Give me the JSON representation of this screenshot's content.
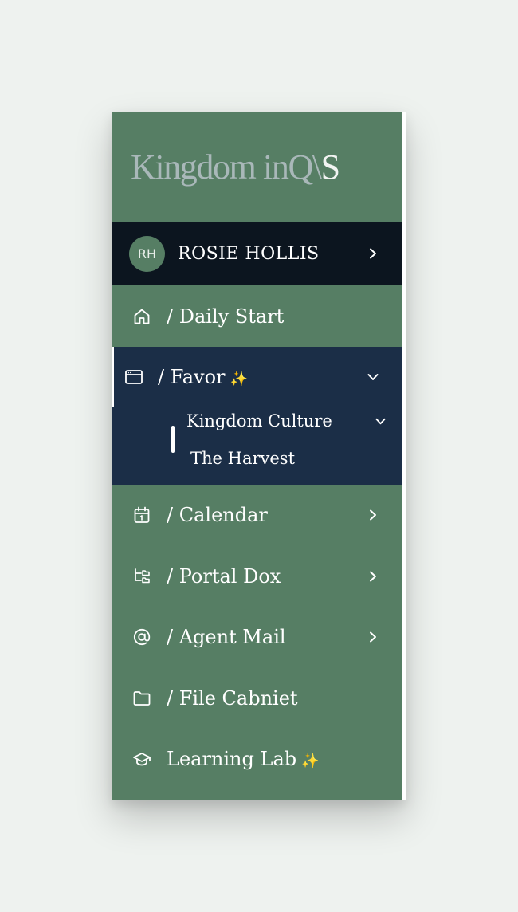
{
  "brand": {
    "logo_main": "Kingdom inQ\\",
    "logo_accent": "S"
  },
  "user": {
    "initials": "RH",
    "name": "ROSIE HOLLIS"
  },
  "nav": {
    "daily_start": "/ Daily Start",
    "favor": "/ Favor",
    "favor_sparkle": "✨",
    "favor_sub": {
      "kingdom_culture": "Kingdom Culture",
      "the_harvest": "The Harvest"
    },
    "calendar": "/ Calendar",
    "portal_dox": "/ Portal Dox",
    "agent_mail": "/ Agent Mail",
    "file_cabinet": "/ File Cabniet",
    "learning_lab": "Learning Lab",
    "learning_lab_sparkle": "✨"
  },
  "colors": {
    "sidebar_bg": "#567e64",
    "user_bar_bg": "#0c151f",
    "active_group_bg": "#1b2e47",
    "logo_text": "#a9b8b9",
    "page_bg": "#eef2ef"
  },
  "icons": {
    "daily_start": "home-icon",
    "favor": "browser-window-icon",
    "calendar": "calendar-icon",
    "portal_dox": "folder-tree-icon",
    "agent_mail": "at-sign-icon",
    "file_cabinet": "folder-icon",
    "learning_lab": "graduation-cap-icon"
  }
}
